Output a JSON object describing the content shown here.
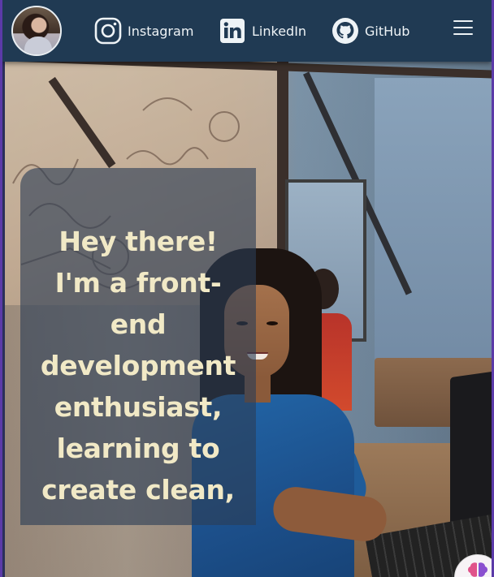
{
  "navbar": {
    "links": [
      {
        "label": "Instagram",
        "icon": "instagram-icon"
      },
      {
        "label": "LinkedIn",
        "icon": "linkedin-icon"
      },
      {
        "label": "GitHub",
        "icon": "github-icon"
      }
    ],
    "menu_icon": "hamburger-menu-icon",
    "background": "#203a53"
  },
  "hero": {
    "intro_lines": [
      "Hey there!",
      "I'm a front-",
      "end",
      "development",
      "enthusiast,",
      "learning to",
      "create clean,"
    ],
    "text_color": "#f1e9c6"
  },
  "floating_button": {
    "icon": "brain-icon"
  }
}
